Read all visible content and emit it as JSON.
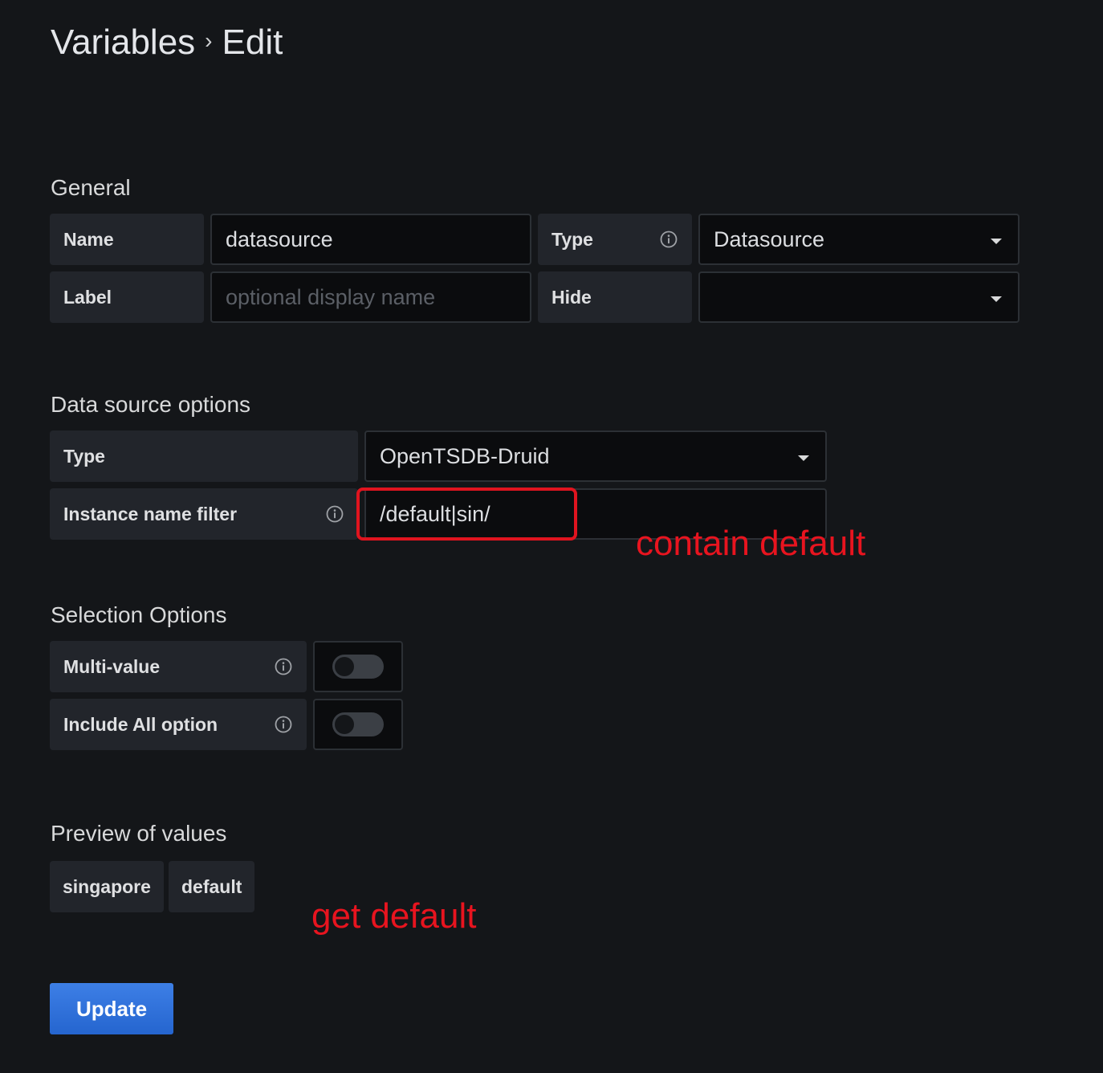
{
  "breadcrumb": {
    "parent": "Variables",
    "separator": "›",
    "current": "Edit"
  },
  "general": {
    "title": "General",
    "name_label": "Name",
    "name_value": "datasource",
    "type_label": "Type",
    "type_value": "Datasource",
    "label_label": "Label",
    "label_placeholder": "optional display name",
    "hide_label": "Hide",
    "hide_value": ""
  },
  "datasource_options": {
    "title": "Data source options",
    "type_label": "Type",
    "type_value": "OpenTSDB-Druid",
    "filter_label": "Instance name filter",
    "filter_value": "/default|sin/"
  },
  "selection_options": {
    "title": "Selection Options",
    "multi_value_label": "Multi-value",
    "multi_value_enabled": false,
    "include_all_label": "Include All option",
    "include_all_enabled": false
  },
  "preview": {
    "title": "Preview of values",
    "values": [
      "singapore",
      "default"
    ]
  },
  "annotations": {
    "filter_note": "contain default",
    "preview_note": "get default"
  },
  "actions": {
    "update_label": "Update"
  },
  "icons": {
    "info": "info-circle-icon",
    "dropdown": "caret-down-icon"
  },
  "colors": {
    "background": "#141619",
    "annotation_red": "#e8141f",
    "primary_button": "#2f6fd8"
  }
}
